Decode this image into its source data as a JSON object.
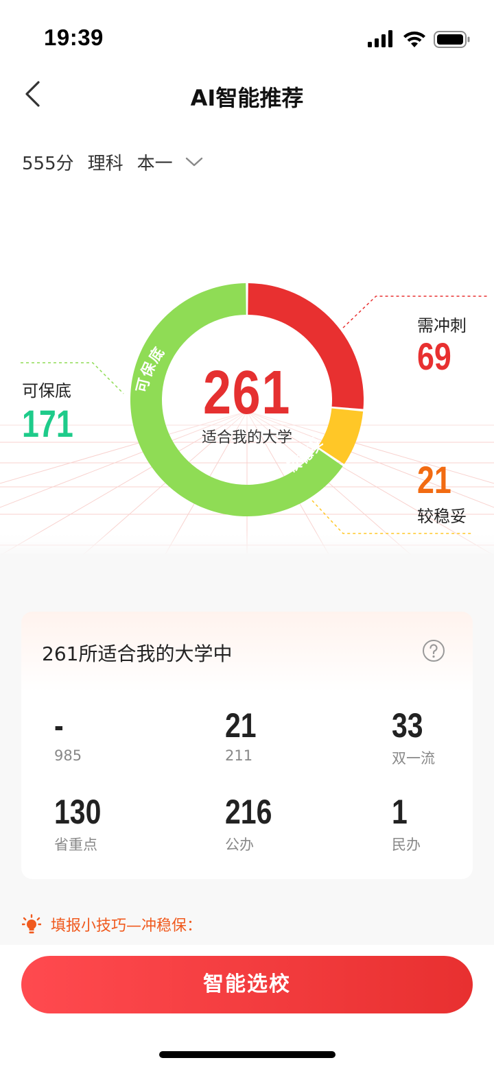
{
  "status_bar": {
    "time": "19:39",
    "icons": [
      "signal-icon",
      "wifi-icon",
      "battery-icon"
    ]
  },
  "nav": {
    "title": "AI智能推荐",
    "back_icon": "chevron-left-icon"
  },
  "filter": {
    "score": "555分",
    "subject": "理科",
    "batch": "本一",
    "dropdown_icon": "chevron-down-icon"
  },
  "chart_data": {
    "type": "pie",
    "total": 261,
    "center_label": "适合我的大学",
    "slices": [
      {
        "label": "需冲刺",
        "value": 69,
        "color": "#e83030"
      },
      {
        "label": "较稳妥",
        "value": 21,
        "color": "#ffc727"
      },
      {
        "label": "可保底",
        "value": 171,
        "color": "#8fdc55"
      }
    ]
  },
  "legend": {
    "reach": {
      "label": "需冲刺",
      "value": "69",
      "color": "#e83030"
    },
    "stable": {
      "label": "较稳妥",
      "value": "21",
      "color": "#f26b12"
    },
    "safe": {
      "label": "可保底",
      "value": "171",
      "color": "#1ecb8a"
    }
  },
  "stats": {
    "title": "261所适合我的大学中",
    "help_icon": "question-circle-icon",
    "items": [
      {
        "value": "-",
        "label": "985"
      },
      {
        "value": "21",
        "label": "211"
      },
      {
        "value": "33",
        "label": "双一流"
      },
      {
        "value": "130",
        "label": "省重点"
      },
      {
        "value": "216",
        "label": "公办"
      },
      {
        "value": "1",
        "label": "民办"
      }
    ]
  },
  "tip": {
    "icon": "lightbulb-icon",
    "text": "填报小技巧—冲稳保："
  },
  "cta": {
    "label": "智能选校"
  },
  "colors": {
    "brand_red": "#e83030",
    "tip_orange": "#f05a1e"
  }
}
